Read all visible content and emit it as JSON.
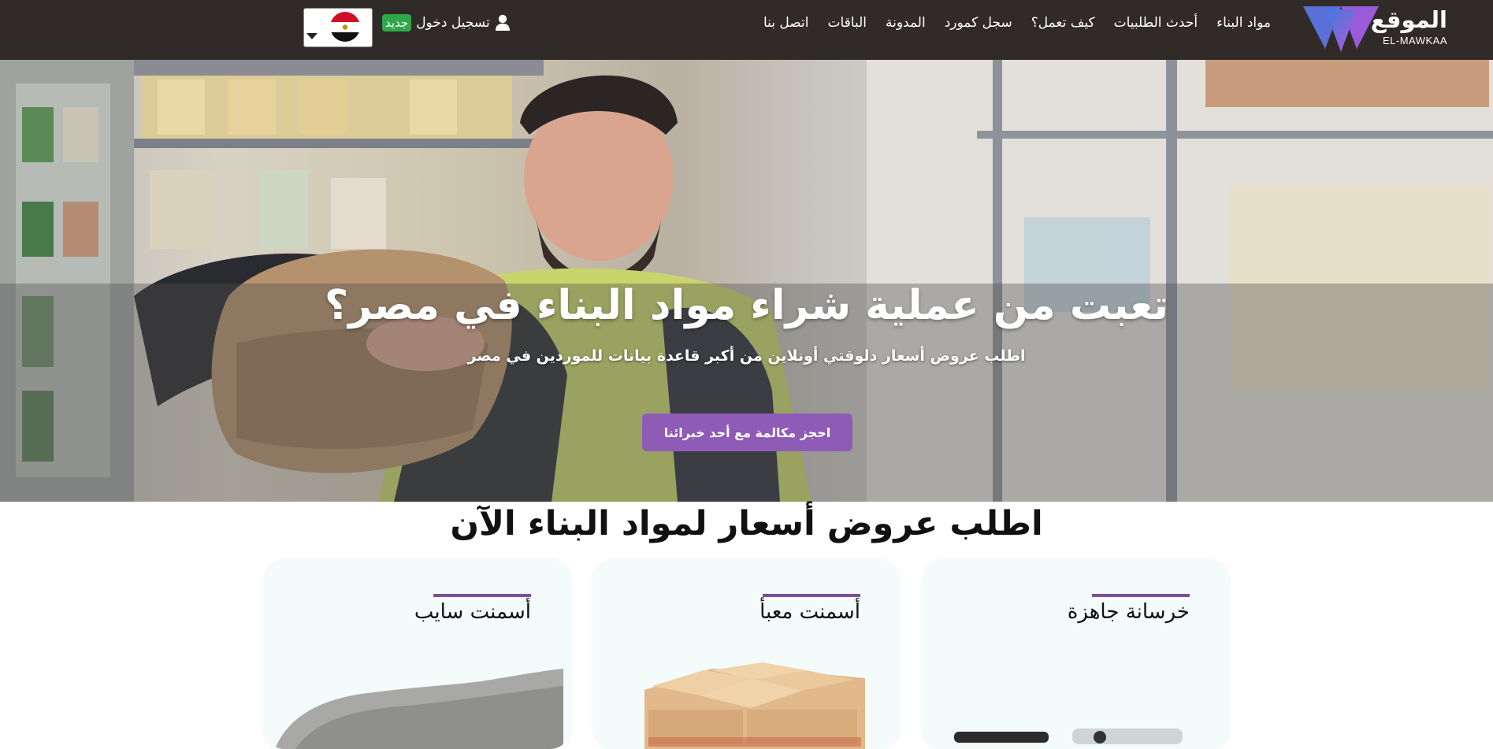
{
  "navbar": {
    "logo_ar": "الموقع",
    "logo_en": "EL-MAWKAA",
    "links": [
      {
        "label": "مواد البناء"
      },
      {
        "label": "أحدث الطلبيات"
      },
      {
        "label": "كيف تعمل؟"
      },
      {
        "label": "سجل كمورد"
      },
      {
        "label": "المدونة"
      },
      {
        "label": "الباقات"
      },
      {
        "label": "اتصل بنا"
      }
    ],
    "login_label": "تسجيل دخول",
    "new_badge": "جديد",
    "language_icon": "egypt-flag-icon"
  },
  "hero": {
    "title": "تعبت من عملية شراء مواد البناء في مصر؟",
    "subtitle": "اطلب عروض أسعار دلوقتي أونلاين من أكبر قاعدة بيانات للموردين في مصر",
    "cta": "احجز مكالمة مع أحد خبرائنا"
  },
  "products": {
    "title": "اطلب عروض أسعار لمواد البناء الآن",
    "cards": [
      {
        "title": "خرسانة جاهزة",
        "icon": "concrete-mixer-truck-image"
      },
      {
        "title": "أسمنت معبأ",
        "icon": "cement-bags-image"
      },
      {
        "title": "أسمنت سايب",
        "icon": "loose-cement-pile-image"
      }
    ]
  },
  "colors": {
    "navbar_bg": "#302b29",
    "accent_purple": "#8e5cb6",
    "badge_green": "#2fa84a",
    "card_bg": "#f3fbfb"
  }
}
